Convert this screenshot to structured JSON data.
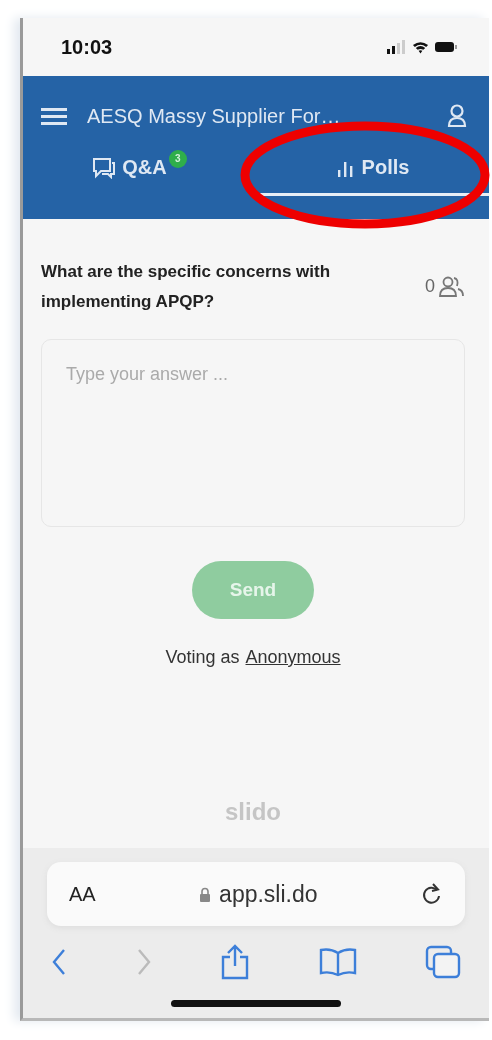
{
  "status_bar": {
    "time": "10:03"
  },
  "header": {
    "title": "AESQ Massy Supplier For…"
  },
  "tabs": [
    {
      "kind": "qa",
      "label": "Q&A",
      "badge": "3",
      "selected": false
    },
    {
      "kind": "polls",
      "label": "Polls",
      "selected": true
    }
  ],
  "poll": {
    "question": "What are the specific concerns with implementing APQP?",
    "participants": "0",
    "answer": {
      "placeholder": "Type your answer ..."
    },
    "send": {
      "label": "Send",
      "disabled": true
    },
    "voting_as": {
      "text": "Voting as",
      "name": "Anonymous"
    }
  },
  "brand": "slido",
  "browser": {
    "text_size": "AA",
    "url": "app.sli.do"
  },
  "annotation": {
    "kind": "ellipse"
  }
}
